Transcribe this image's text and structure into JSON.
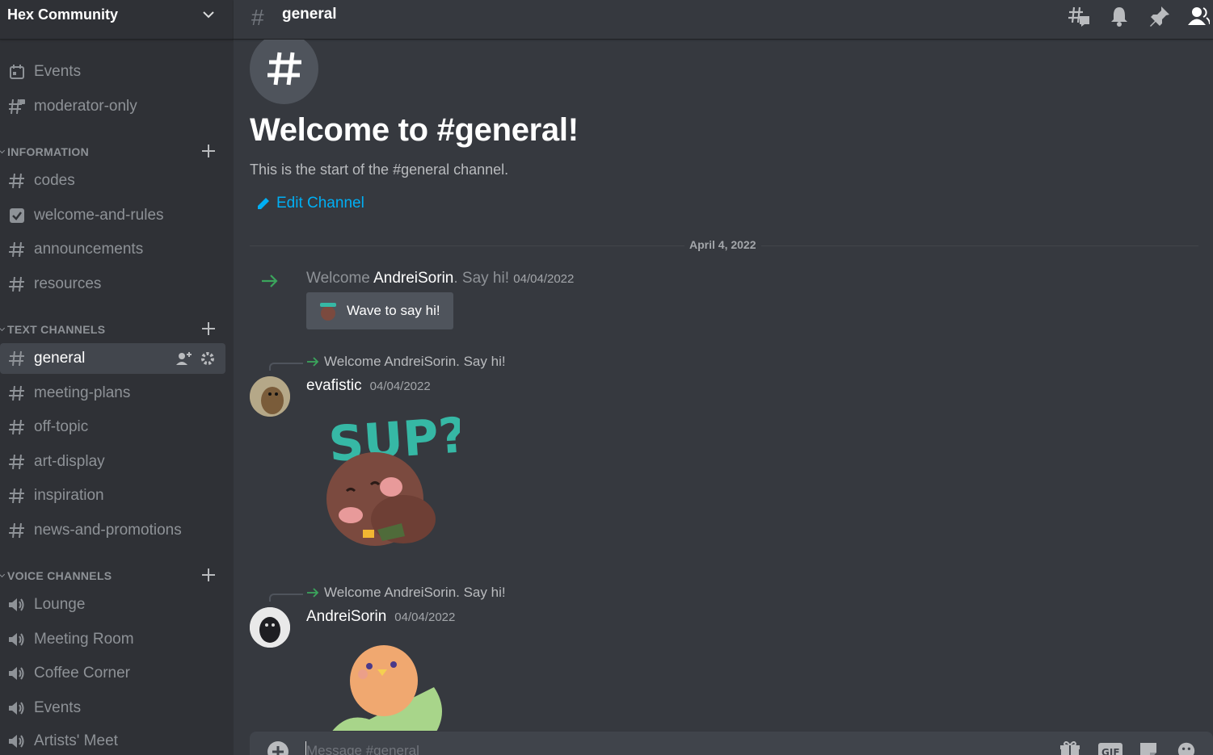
{
  "server": {
    "name": "Hex Community"
  },
  "channels_top": [
    {
      "label": "Events",
      "icon": "calendar-icon"
    },
    {
      "label": "moderator-only",
      "icon": "locked-hash-icon"
    }
  ],
  "categories": {
    "information": "INFORMATION",
    "text": "TEXT CHANNELS",
    "voice": "VOICE CHANNELS"
  },
  "information_channels": [
    {
      "label": "codes",
      "icon": "hash-icon"
    },
    {
      "label": "welcome-and-rules",
      "icon": "checkbox-icon"
    },
    {
      "label": "announcements",
      "icon": "hash-icon"
    },
    {
      "label": "resources",
      "icon": "hash-icon"
    }
  ],
  "text_channels": [
    {
      "label": "general",
      "icon": "hash-icon",
      "active": true
    },
    {
      "label": "meeting-plans",
      "icon": "hash-icon"
    },
    {
      "label": "off-topic",
      "icon": "hash-icon"
    },
    {
      "label": "art-display",
      "icon": "hash-icon"
    },
    {
      "label": "inspiration",
      "icon": "hash-icon"
    },
    {
      "label": "news-and-promotions",
      "icon": "hash-icon"
    }
  ],
  "voice_channels": [
    {
      "label": "Lounge",
      "icon": "speaker-icon"
    },
    {
      "label": "Meeting Room",
      "icon": "speaker-icon"
    },
    {
      "label": "Coffee Corner",
      "icon": "speaker-icon"
    },
    {
      "label": "Events",
      "icon": "speaker-icon"
    },
    {
      "label": "Artists' Meet",
      "icon": "speaker-icon"
    }
  ],
  "header": {
    "hash": "#",
    "channel": "general"
  },
  "intro": {
    "title": "Welcome to #general!",
    "subtitle": "This is the start of the #general channel.",
    "edit_label": "Edit Channel"
  },
  "date_divider": "April 4, 2022",
  "join_message": {
    "prefix": "Welcome ",
    "user": "AndreiSorin",
    "suffix": ". Say hi!",
    "timestamp": "04/04/2022",
    "wave_label": "Wave to say hi!"
  },
  "messages": [
    {
      "reply_text": "Welcome AndreiSorin. Say hi!",
      "author": "evafistic",
      "timestamp": "04/04/2022",
      "sticker_text": "SUP?"
    },
    {
      "reply_text": "Welcome AndreiSorin. Say hi!",
      "author": "AndreiSorin",
      "timestamp": "04/04/2022"
    }
  ],
  "composer": {
    "placeholder": "Message #general",
    "gif_label": "GIF"
  },
  "colors": {
    "accent_link": "#00aff4",
    "join_arrow": "#3ba55c",
    "sidebar_bg": "#2f3136",
    "chat_bg": "#36393f"
  }
}
